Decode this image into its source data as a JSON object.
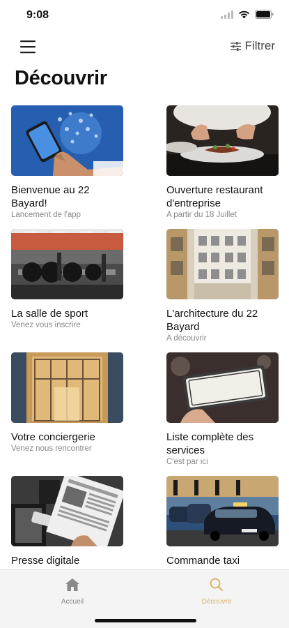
{
  "status_bar": {
    "time": "9:08"
  },
  "top_bar": {
    "filter_label": "Filtrer"
  },
  "page": {
    "title": "Découvrir"
  },
  "cards": [
    {
      "title": "Bienvenue au 22 Bayard!",
      "subtitle": "Lancement de l'app",
      "image": "phone-with-app-icons"
    },
    {
      "title": "Ouverture restaurant d'entreprise",
      "subtitle": "A partir du 18 Juillet",
      "image": "chef-plating-dish"
    },
    {
      "title": "La salle de sport",
      "subtitle": "Venez vous inscrire",
      "image": "gym-weights"
    },
    {
      "title": "L'architecture du 22 Bayard",
      "subtitle": "A découvrir",
      "image": "building-courtyard"
    },
    {
      "title": "Votre conciergerie",
      "subtitle": "Venez nous rencontrer",
      "image": "glass-entrance-doors"
    },
    {
      "title": "Liste complète des services",
      "subtitle": "C'est par ici",
      "image": "open-sign"
    },
    {
      "title": "Presse digitale",
      "subtitle": "",
      "image": "newspaper-reading"
    },
    {
      "title": "Commande taxi",
      "subtitle": "",
      "image": "taxi-in-traffic"
    }
  ],
  "tab_bar": {
    "tabs": [
      {
        "label": "Accueil",
        "icon": "home-icon",
        "active": false
      },
      {
        "label": "Découvrir",
        "icon": "search-icon",
        "active": true
      }
    ],
    "active_color": "#d9b46a",
    "inactive_color": "#8a8a8a"
  }
}
